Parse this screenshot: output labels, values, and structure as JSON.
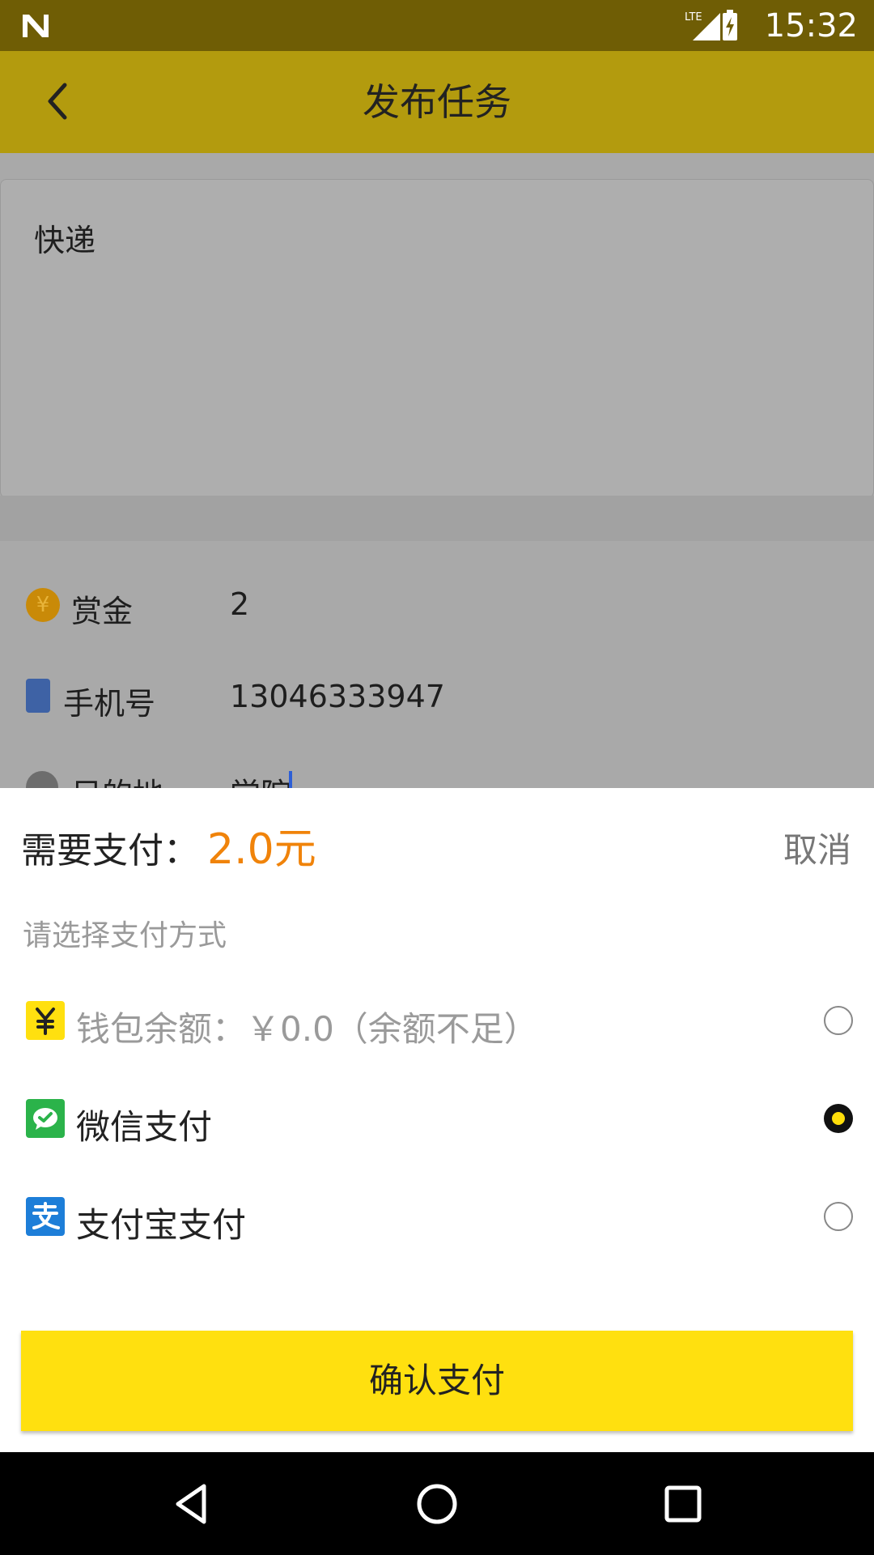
{
  "status_bar": {
    "time": "15:32",
    "network": "LTE",
    "logo": "N"
  },
  "app_bar": {
    "title": "发布任务",
    "back_icon": "back-chevron-icon"
  },
  "form": {
    "description": "快递",
    "fields": [
      {
        "label": "赏金",
        "value": "2",
        "icon": "coin-icon"
      },
      {
        "label": "手机号",
        "value": "13046333947",
        "icon": "phone-icon"
      },
      {
        "label": "目的地",
        "value": "学院",
        "icon": "location-icon"
      }
    ]
  },
  "payment_sheet": {
    "need_pay_label": "需要支付：",
    "amount": "2.0元",
    "cancel_label": "取消",
    "choose_hint": "请选择支付方式",
    "options": [
      {
        "label": "钱包余额：￥0.0（余额不足）",
        "icon": "wallet-yuan-icon",
        "selected": false,
        "disabled": true
      },
      {
        "label": "微信支付",
        "icon": "wechat-icon",
        "selected": true,
        "disabled": false
      },
      {
        "label": "支付宝支付",
        "icon": "alipay-icon",
        "selected": false,
        "disabled": false
      }
    ],
    "confirm_label": "确认支付"
  },
  "colors": {
    "status_bar": "#6f5d05",
    "app_bar": "#b39b0e",
    "accent_yellow": "#ffe00f",
    "amount_orange": "#f0830a",
    "wechat_green": "#2bb34a",
    "alipay_blue": "#1d7ed8"
  }
}
